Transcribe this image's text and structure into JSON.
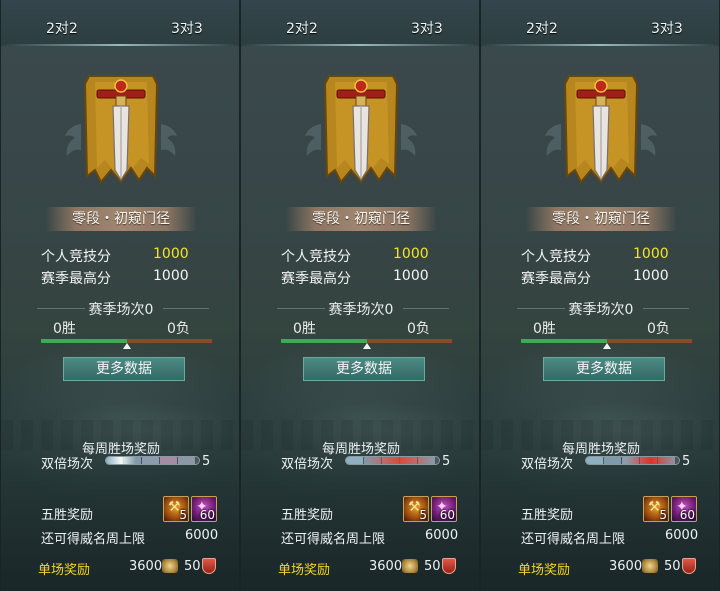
{
  "panels": [
    {
      "tab_left": "2对2",
      "tab_right": "3对3",
      "rank_name": "零段・初窥门径",
      "personal_score_label": "个人竞技分",
      "personal_score": "1000",
      "season_high_label": "赛季最高分",
      "season_high": "1000",
      "season_matches": "赛季场次0",
      "wins": "0胜",
      "losses": "0负",
      "win_ratio": 0.5,
      "more_data": "更多数据",
      "weekly_reward_title": "每周胜场奖励",
      "double_label": "双倍场次",
      "double_count": "5",
      "five_win_label": "五胜奖励",
      "item_gold_count": "5",
      "item_purple_count": "60",
      "weekly_cap_label": "还可得威名周上限",
      "weekly_cap_value": "6000",
      "single_reward_label": "单场奖励",
      "single_reward_a": "3600",
      "single_reward_b": "50"
    },
    {
      "tab_left": "2对2",
      "tab_right": "3对3",
      "rank_name": "零段・初窥门径",
      "personal_score_label": "个人竞技分",
      "personal_score": "1000",
      "season_high_label": "赛季最高分",
      "season_high": "1000",
      "season_matches": "赛季场次0",
      "wins": "0胜",
      "losses": "0负",
      "win_ratio": 0.5,
      "more_data": "更多数据",
      "weekly_reward_title": "每周胜场奖励",
      "double_label": "双倍场次",
      "double_count": "5",
      "five_win_label": "五胜奖励",
      "item_gold_count": "5",
      "item_purple_count": "60",
      "weekly_cap_label": "还可得威名周上限",
      "weekly_cap_value": "6000",
      "single_reward_label": "单场奖励",
      "single_reward_a": "3600",
      "single_reward_b": "50"
    },
    {
      "tab_left": "2对2",
      "tab_right": "3对3",
      "rank_name": "零段・初窥门径",
      "personal_score_label": "个人竞技分",
      "personal_score": "1000",
      "season_high_label": "赛季最高分",
      "season_high": "1000",
      "season_matches": "赛季场次0",
      "wins": "0胜",
      "losses": "0负",
      "win_ratio": 0.5,
      "more_data": "更多数据",
      "weekly_reward_title": "每周胜场奖励",
      "double_label": "双倍场次",
      "double_count": "5",
      "five_win_label": "五胜奖励",
      "item_gold_count": "5",
      "item_purple_count": "60",
      "weekly_cap_label": "还可得威名周上限",
      "weekly_cap_value": "6000",
      "single_reward_label": "单场奖励",
      "single_reward_a": "3600",
      "single_reward_b": "50"
    }
  ],
  "colors": {
    "score_highlight": "#f2e42a",
    "single_reward_label": "#f2d62a",
    "win_bar": "#3fa85a",
    "loss_bar": "#8a4a2a",
    "button": "#3f7c76"
  },
  "icons": {
    "emblem": "sword-banner-icon",
    "gold_item": "gold-item-icon",
    "purple_item": "purple-item-icon",
    "coin": "coin-icon",
    "shield": "shield-icon"
  }
}
